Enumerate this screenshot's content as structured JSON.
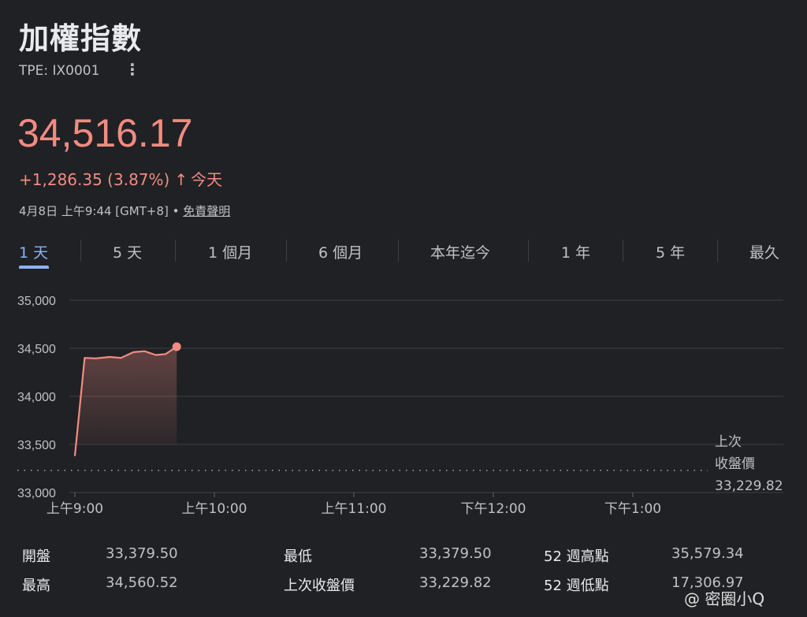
{
  "header": {
    "title": "加權指數",
    "ticker": "TPE: IX0001",
    "more_icon": "vertical-dots-icon"
  },
  "quote": {
    "price": "34,516.17",
    "change": "+1,286.35 (3.87%)",
    "arrow_icon": "arrow-up-icon",
    "arrow": "↑",
    "period": "今天",
    "timestamp": "4月8日 上午9:44 [GMT+8] • ",
    "disclaimer": "免責聲明",
    "color": "#f28b82"
  },
  "tabs": [
    "1 天",
    "5 天",
    "1 個月",
    "6 個月",
    "本年迄今",
    "1 年",
    "5 年",
    "最久"
  ],
  "active_tab": "1 天",
  "chart_data": {
    "type": "area",
    "x_tick_labels": [
      "上午9:00",
      "上午10:00",
      "上午11:00",
      "下午12:00",
      "下午1:00"
    ],
    "y_tick_labels": [
      "35,000",
      "34,500",
      "34,000",
      "33,500",
      "33,000"
    ],
    "ylim": [
      33000,
      35000
    ],
    "x_range_hours": [
      9.0,
      13.5
    ],
    "x_hours": [
      9.0,
      9.07,
      9.15,
      9.25,
      9.33,
      9.42,
      9.5,
      9.58,
      9.65,
      9.73
    ],
    "values": [
      33379.5,
      34400,
      34395,
      34410,
      34400,
      34460,
      34470,
      34430,
      34440,
      34516.17
    ],
    "previous_close": 33229.82,
    "previous_close_label": [
      "上次",
      "收盤價",
      "33,229.82"
    ],
    "grid": true,
    "line_color": "#f28b82"
  },
  "stats": {
    "left": [
      {
        "label": "開盤",
        "value": "33,379.50"
      },
      {
        "label": "最高",
        "value": "34,560.52"
      }
    ],
    "middle": [
      {
        "label": "最低",
        "value": "33,379.50"
      },
      {
        "label": "上次收盤價",
        "value": "33,229.82"
      }
    ],
    "right": [
      {
        "label": "52 週高點",
        "value": "35,579.34"
      },
      {
        "label": "52 週低點",
        "value": "17,306.97"
      }
    ]
  },
  "watermark": "@ 密圈小Q"
}
